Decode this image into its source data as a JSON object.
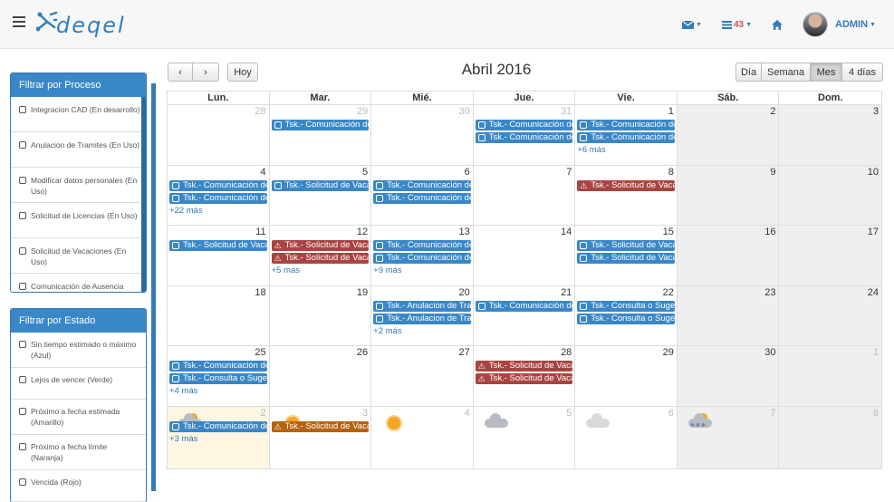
{
  "topbar": {
    "logo_text": "deqel",
    "mail_icon": "envelope-icon",
    "tasks_count": "43",
    "home_icon": "home-icon",
    "user": "ADMIN"
  },
  "sidebar": {
    "process_panel": {
      "title": "Filtrar por Proceso",
      "items": [
        "Integracion CAD (En desarrollo)",
        "Anulacion de Tramites (En Uso)",
        "Modificar datos personales (En Uso)",
        "Solicitud de Licencias (En Uso)",
        "Solicitud de Vacaciones (En Uso)",
        "Comunicación de Ausencia"
      ]
    },
    "state_panel": {
      "title": "Filtrar por Estado",
      "items": [
        "Sin tiempo estimado o máximo (Azul)",
        "Lejos de vencer (Verde)",
        "Próximo a fecha estimada (Amarillo)",
        "Próximo a fecha límite (Naranja)",
        "Vencida (Rojo)"
      ]
    }
  },
  "toolbar": {
    "prev": "‹",
    "next": "›",
    "today": "Hoy",
    "title": "Abril 2016",
    "views": [
      "Día",
      "Semana",
      "Mes",
      "4 días"
    ],
    "active_view": "Mes"
  },
  "calendar": {
    "days_of_week": [
      "Lun.",
      "Mar.",
      "Mié.",
      "Jue.",
      "Vie.",
      "Sáb.",
      "Dom."
    ],
    "weeks": [
      [
        {
          "n": "28",
          "other": true,
          "events": [],
          "more": ""
        },
        {
          "n": "29",
          "other": true,
          "events": [
            {
              "t": "Tsk.- Comunicación de Ausencia",
              "c": "blue",
              "i": "sq"
            }
          ],
          "more": ""
        },
        {
          "n": "30",
          "other": true,
          "events": [],
          "more": ""
        },
        {
          "n": "31",
          "other": true,
          "events": [
            {
              "t": "Tsk.- Comunicación de Ausencia",
              "c": "blue",
              "i": "sq"
            },
            {
              "t": "Tsk.- Comunicación de Ausencia",
              "c": "blue",
              "i": "sq"
            }
          ],
          "more": ""
        },
        {
          "n": "1",
          "events": [
            {
              "t": "Tsk.- Comunicación de Ausencia",
              "c": "blue",
              "i": "sq"
            },
            {
              "t": "Tsk.- Comunicación de Ausencia",
              "c": "blue",
              "i": "sq"
            }
          ],
          "more": "+6 más"
        },
        {
          "n": "2",
          "weekend": true,
          "events": [],
          "more": ""
        },
        {
          "n": "3",
          "weekend": true,
          "events": [],
          "more": ""
        }
      ],
      [
        {
          "n": "4",
          "events": [
            {
              "t": "Tsk.- Comunicación de Ausencia",
              "c": "blue",
              "i": "sq"
            },
            {
              "t": "Tsk.- Comunicación de Ausencia",
              "c": "blue",
              "i": "sq"
            }
          ],
          "more": "+22 más"
        },
        {
          "n": "5",
          "events": [
            {
              "t": "Tsk.- Solicitud de Vacaciones",
              "c": "blue",
              "i": "sq"
            }
          ],
          "more": ""
        },
        {
          "n": "6",
          "events": [
            {
              "t": "Tsk.- Comunicación de Ausencia",
              "c": "blue",
              "i": "sq"
            },
            {
              "t": "Tsk.- Comunicación de Ausencia",
              "c": "blue",
              "i": "sq"
            }
          ],
          "more": ""
        },
        {
          "n": "7",
          "events": [],
          "more": ""
        },
        {
          "n": "8",
          "events": [
            {
              "t": "Tsk.- Solicitud de Vacaciones",
              "c": "red",
              "i": "warn"
            }
          ],
          "more": ""
        },
        {
          "n": "9",
          "weekend": true,
          "events": [],
          "more": ""
        },
        {
          "n": "10",
          "weekend": true,
          "events": [],
          "more": ""
        }
      ],
      [
        {
          "n": "11",
          "events": [
            {
              "t": "Tsk.- Solicitud de Vacaciones",
              "c": "blue",
              "i": "sq"
            }
          ],
          "more": ""
        },
        {
          "n": "12",
          "events": [
            {
              "t": "Tsk.- Solicitud de Vacaciones",
              "c": "red",
              "i": "warn"
            },
            {
              "t": "Tsk.- Solicitud de Vacaciones",
              "c": "red",
              "i": "warn"
            }
          ],
          "more": "+5 más"
        },
        {
          "n": "13",
          "events": [
            {
              "t": "Tsk.- Comunicación de Ausencia",
              "c": "blue",
              "i": "sq"
            },
            {
              "t": "Tsk.- Comunicación de Ausencia",
              "c": "blue",
              "i": "sq"
            }
          ],
          "more": "+9 más"
        },
        {
          "n": "14",
          "events": [],
          "more": ""
        },
        {
          "n": "15",
          "events": [
            {
              "t": "Tsk.- Solicitud de Vacaciones",
              "c": "blue",
              "i": "sq"
            },
            {
              "t": "Tsk.- Solicitud de Vacaciones",
              "c": "blue",
              "i": "sq"
            }
          ],
          "more": ""
        },
        {
          "n": "16",
          "weekend": true,
          "events": [],
          "more": ""
        },
        {
          "n": "17",
          "weekend": true,
          "events": [],
          "more": ""
        }
      ],
      [
        {
          "n": "18",
          "events": [],
          "more": ""
        },
        {
          "n": "19",
          "events": [],
          "more": ""
        },
        {
          "n": "20",
          "events": [
            {
              "t": "Tsk.- Anulacion de Tramites",
              "c": "blue",
              "i": "sq"
            },
            {
              "t": "Tsk.- Anulacion de Tramites",
              "c": "blue",
              "i": "sq"
            }
          ],
          "more": "+2 más"
        },
        {
          "n": "21",
          "events": [
            {
              "t": "Tsk.- Comunicación de Ausencia",
              "c": "blue",
              "i": "sq"
            }
          ],
          "more": ""
        },
        {
          "n": "22",
          "events": [
            {
              "t": "Tsk.- Consulta o Sugerencia",
              "c": "blue",
              "i": "sq"
            },
            {
              "t": "Tsk.- Consulta o Sugerencia",
              "c": "blue",
              "i": "sq"
            }
          ],
          "more": ""
        },
        {
          "n": "23",
          "weekend": true,
          "events": [],
          "more": ""
        },
        {
          "n": "24",
          "weekend": true,
          "events": [],
          "more": ""
        }
      ],
      [
        {
          "n": "25",
          "events": [
            {
              "t": "Tsk.- Comunicación de Ausencia",
              "c": "blue",
              "i": "sq"
            },
            {
              "t": "Tsk.- Consulta o Sugerencia",
              "c": "blue",
              "i": "sq"
            }
          ],
          "more": "+4 más"
        },
        {
          "n": "26",
          "events": [],
          "more": ""
        },
        {
          "n": "27",
          "events": [],
          "more": ""
        },
        {
          "n": "28",
          "events": [
            {
              "t": "Tsk.- Solicitud de Vacaciones",
              "c": "red",
              "i": "warn"
            },
            {
              "t": "Tsk.- Solicitud de Vacaciones",
              "c": "red",
              "i": "warn"
            }
          ],
          "more": ""
        },
        {
          "n": "29",
          "events": [],
          "more": ""
        },
        {
          "n": "30",
          "weekend": true,
          "events": [],
          "more": ""
        },
        {
          "n": "1",
          "weekend": true,
          "other": true,
          "events": [],
          "more": ""
        }
      ],
      [
        {
          "n": "2",
          "other": true,
          "today": true,
          "weather": "snow",
          "events": [
            {
              "t": "Tsk.- Comunicación de Ausencia",
              "c": "blue",
              "i": "sq"
            }
          ],
          "more": "+3 más"
        },
        {
          "n": "3",
          "other": true,
          "weather": "sun",
          "events": [
            {
              "t": "Tsk.- Solicitud de Vacaciones",
              "c": "orange",
              "i": "warn"
            }
          ],
          "more": ""
        },
        {
          "n": "4",
          "other": true,
          "weather": "sun",
          "events": [],
          "more": ""
        },
        {
          "n": "5",
          "other": true,
          "weather": "cloud-dark",
          "events": [],
          "more": ""
        },
        {
          "n": "6",
          "other": true,
          "weather": "cloud",
          "events": [],
          "more": ""
        },
        {
          "n": "7",
          "other": true,
          "weekend": true,
          "weather": "snow",
          "events": [],
          "more": ""
        },
        {
          "n": "8",
          "other": true,
          "weekend": true,
          "events": [],
          "more": ""
        }
      ]
    ]
  },
  "colors": {
    "primary": "#3a87c8",
    "danger": "#a94442",
    "warning": "#b8610e"
  }
}
